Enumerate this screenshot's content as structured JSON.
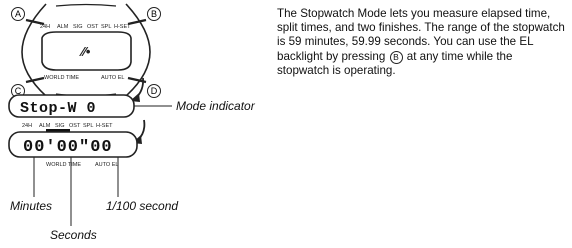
{
  "description": {
    "part1": "The Stopwatch Mode lets you measure elapsed time, split times, and two finishes. The range of the stopwatch is 59 minutes, 59.99 seconds. You can use the EL backlight by pressing",
    "button_glyph": "B",
    "part2": "at any time while the stopwatch is operating."
  },
  "watch": {
    "buttons": [
      "A",
      "B",
      "C",
      "D"
    ],
    "top_labels": [
      "24H",
      "ALM",
      "SIG",
      "OST",
      "SPL",
      "H-SET"
    ],
    "bottom_labels": [
      "WORLD TIME",
      "AUTO EL"
    ],
    "icon_display": "⁄⁄•"
  },
  "mode_display": {
    "text": "Stop-W 0",
    "top_labels": [
      "24H",
      "ALM",
      "SIG",
      "OST",
      "SPL",
      "H-SET"
    ]
  },
  "time_display": {
    "text": "00'00\"00",
    "bottom_labels": [
      "WORLD TIME",
      "AUTO EL"
    ]
  },
  "callouts": {
    "mode_indicator": "Mode indicator",
    "minutes": "Minutes",
    "seconds": "Seconds",
    "hundredths": "1/100 second"
  }
}
